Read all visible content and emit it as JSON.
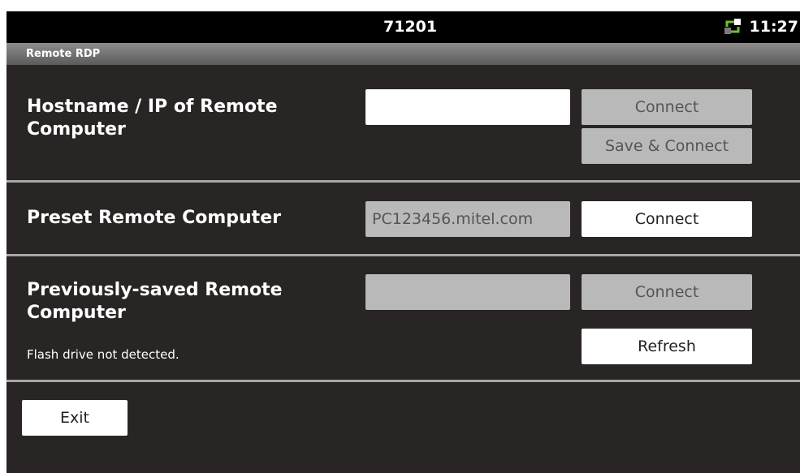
{
  "status_bar": {
    "title": "71201",
    "time": "11:27",
    "network_icon": "network-activity-icon"
  },
  "app_bar": {
    "title": "Remote RDP"
  },
  "hostname_section": {
    "label": "Hostname / IP of Remote Computer",
    "input_value": "",
    "connect_label": "Connect",
    "save_connect_label": "Save & Connect"
  },
  "preset_section": {
    "label": "Preset Remote Computer",
    "value": "PC123456.mitel.com",
    "connect_label": "Connect"
  },
  "saved_section": {
    "label": "Previously-saved Remote Computer",
    "value": "",
    "connect_label": "Connect",
    "status": "Flash drive not detected.",
    "refresh_label": "Refresh"
  },
  "exit_label": "Exit"
}
